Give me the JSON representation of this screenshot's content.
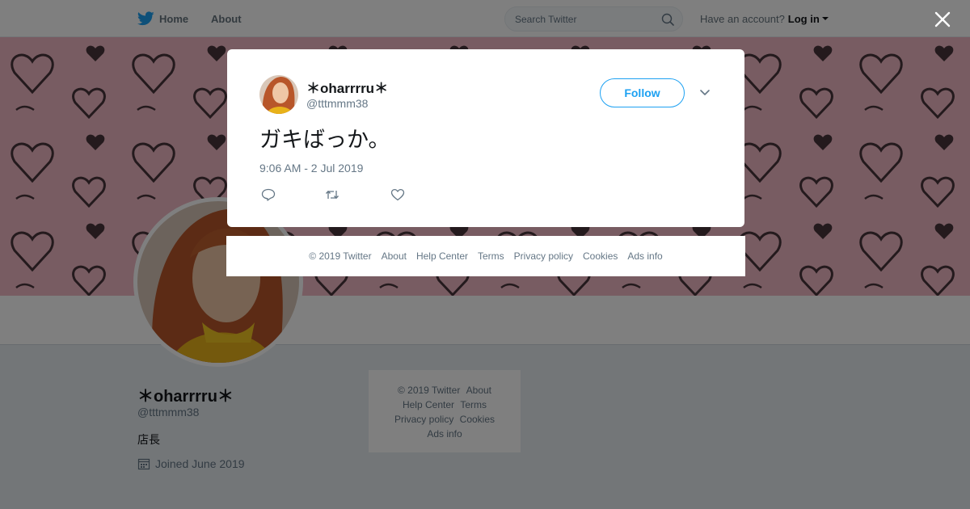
{
  "topbar": {
    "home_label": "Home",
    "about_label": "About",
    "search_placeholder": "Search Twitter",
    "have_account": "Have an account?",
    "login_label": "Log in"
  },
  "profile": {
    "name": "＊oharrrru＊",
    "handle": "@tttmmm38",
    "bio": "店長",
    "joined": "Joined June 2019"
  },
  "side_footer": {
    "copyright": "© 2019 Twitter",
    "about": "About",
    "help_center": "Help Center",
    "terms": "Terms",
    "privacy": "Privacy policy",
    "cookies": "Cookies",
    "ads_info": "Ads info"
  },
  "tweet": {
    "name": "＊oharrrru＊",
    "handle": "@tttmmm38",
    "follow_label": "Follow",
    "text": "ガキばっか。",
    "timestamp": "9:06 AM - 2 Jul 2019"
  },
  "modal_footer": {
    "copyright": "© 2019 Twitter",
    "about": "About",
    "help_center": "Help Center",
    "terms": "Terms",
    "privacy": "Privacy policy",
    "cookies": "Cookies",
    "ads_info": "Ads info"
  },
  "colors": {
    "accent": "#1da1f2",
    "banner_pink": "#f0b9c5",
    "overlay": "rgba(0,0,0,0.5)"
  }
}
